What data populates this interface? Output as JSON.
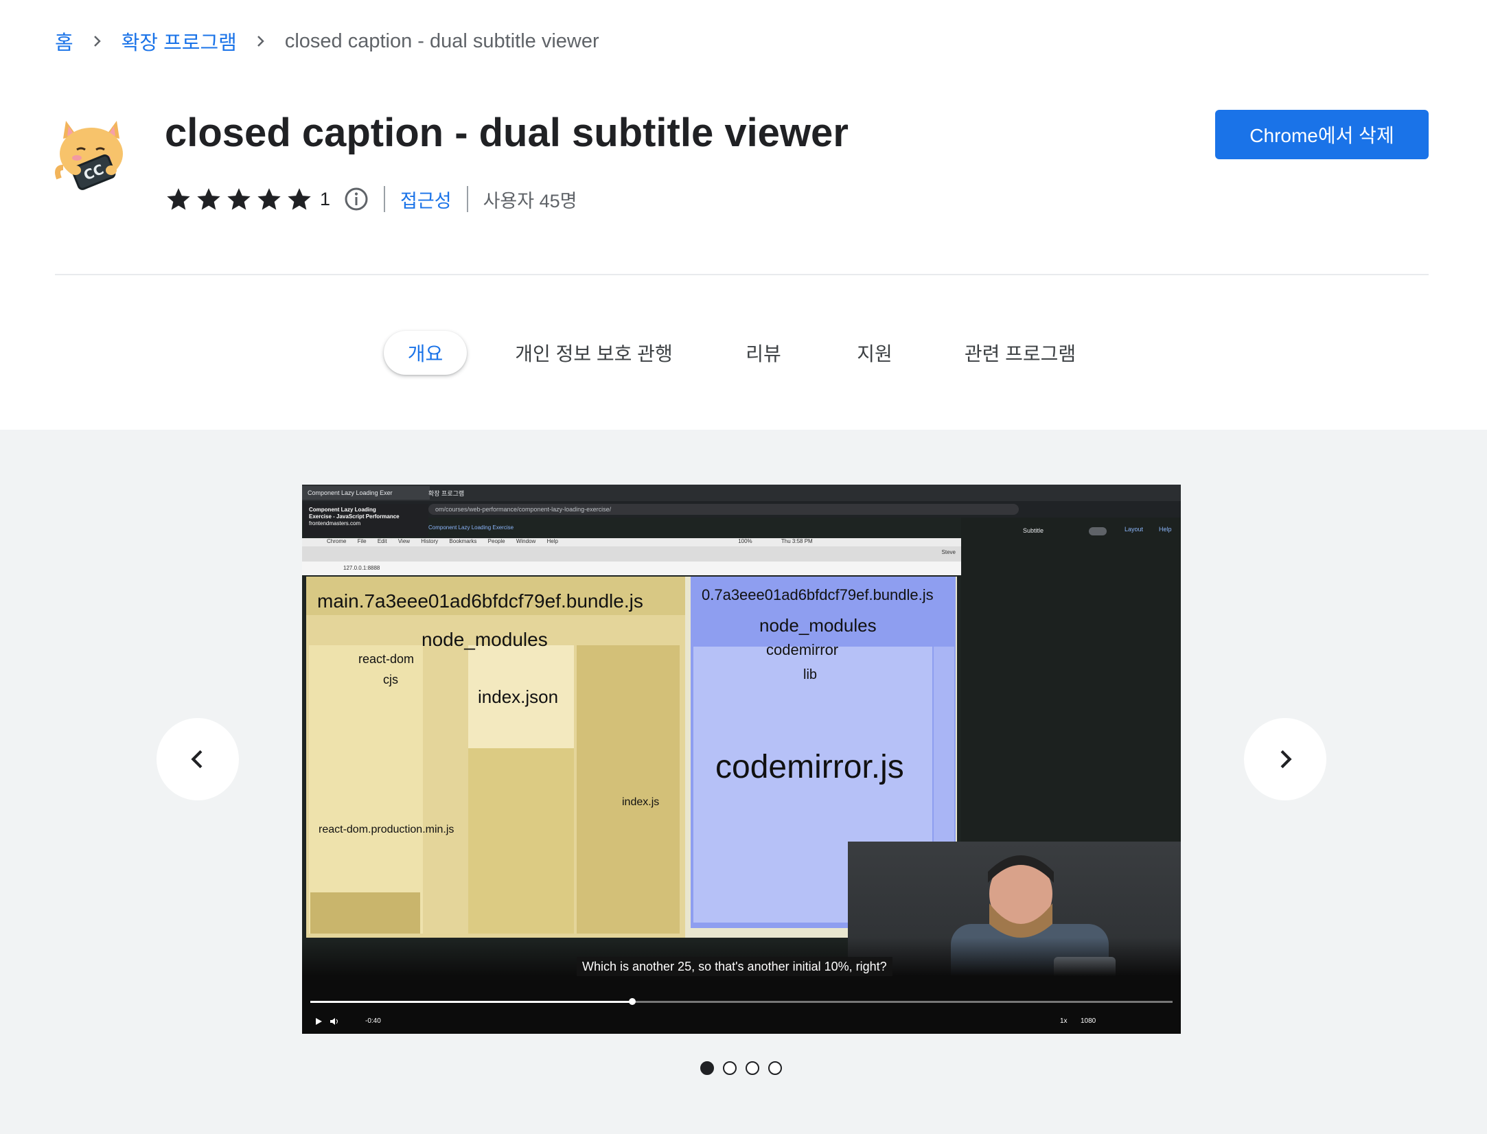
{
  "breadcrumb": {
    "home": "홈",
    "extensions": "확장 프로그램",
    "current": "closed caption - dual subtitle viewer"
  },
  "extension": {
    "title": "closed caption - dual subtitle viewer",
    "rating": 5,
    "rating_count": "1",
    "accessibility_link": "접근성",
    "users": "사용자 45명",
    "remove_button": "Chrome에서 삭제",
    "icon": "cat-holding-cc-icon"
  },
  "tabs": [
    {
      "label": "개요",
      "active": true
    },
    {
      "label": "개인 정보 보호 관행",
      "active": false
    },
    {
      "label": "리뷰",
      "active": false
    },
    {
      "label": "지원",
      "active": false
    },
    {
      "label": "관련 프로그램",
      "active": false
    }
  ],
  "gallery": {
    "prev_icon": "chevron-left-icon",
    "next_icon": "chevron-right-icon",
    "current_slide": 1,
    "slide_count": 4,
    "screenshot": {
      "browser_tab_1": "Component Lazy Loading Exer",
      "browser_tab_2": "확장 프로그램",
      "tooltip_lines": [
        "Component Lazy Loading",
        "Exercise - JavaScript Performance",
        "frontendmasters.com"
      ],
      "url": "om/courses/web-performance/component-lazy-loading-exercise/",
      "page_crumb": "Component Lazy Loading Exercise",
      "subtitle_toggle_label": "Subtitle",
      "layout_label": "Layout",
      "help_label": "Help",
      "mac_menu": [
        "Chrome",
        "File",
        "Edit",
        "View",
        "History",
        "Bookmarks",
        "People",
        "Window",
        "Help"
      ],
      "mac_clock": "Thu 3:58 PM",
      "mac_battery": "100%",
      "user_label": "Steve",
      "inner_url": "127.0.0.1:8888",
      "treemap": {
        "left_bundle": "main.7a3eee01ad6bfdcf79ef.bundle.js",
        "left_modules": "node_modules",
        "react_dom": "react-dom",
        "cjs": "cjs",
        "react_dom_prod": "react-dom.production.min.js",
        "index_json": "index.json",
        "index_js": "index.js",
        "right_bundle": "0.7a3eee01ad6bfdcf79ef.bundle.js",
        "right_modules": "node_modules",
        "codemirror": "codemirror",
        "lib": "lib",
        "codemirror_js": "codemirror.js"
      },
      "caption": "Which is another 25, so that's another initial 10%, right?",
      "time": "-0:40",
      "speed": "1x",
      "quality": "1080"
    }
  }
}
